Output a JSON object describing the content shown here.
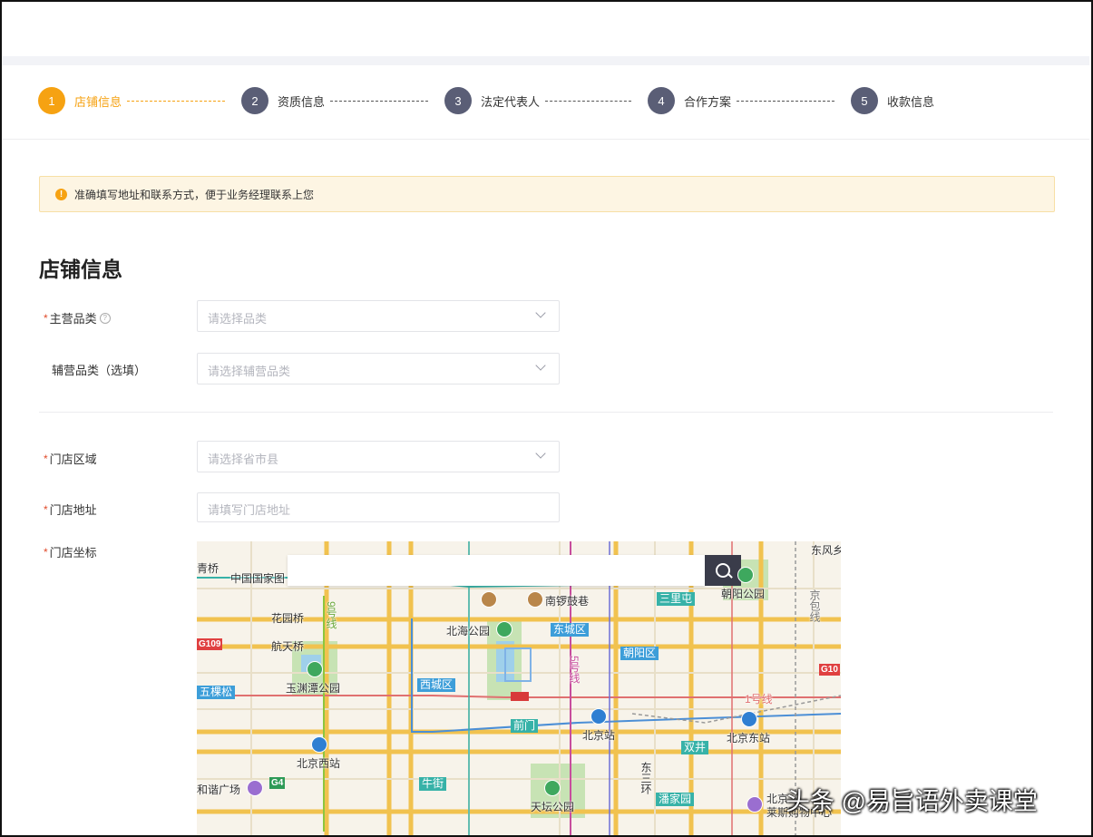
{
  "steps": [
    {
      "num": "1",
      "label": "店铺信息",
      "active": true
    },
    {
      "num": "2",
      "label": "资质信息",
      "active": false
    },
    {
      "num": "3",
      "label": "法定代表人",
      "active": false
    },
    {
      "num": "4",
      "label": "合作方案",
      "active": false
    },
    {
      "num": "5",
      "label": "收款信息",
      "active": false
    }
  ],
  "notice": {
    "icon": "warning-icon",
    "text": "准确填写地址和联系方式，便于业务经理联系上您"
  },
  "section_title": "店铺信息",
  "form": {
    "main_category": {
      "required_mark": "*",
      "label": "主营品类",
      "help_icon": "?",
      "placeholder": "请选择品类"
    },
    "sub_category": {
      "label": "辅营品类（选填）",
      "placeholder": "请选择辅营品类"
    },
    "store_region": {
      "required_mark": "*",
      "label": "门店区域",
      "placeholder": "请选择省市县"
    },
    "store_address": {
      "required_mark": "*",
      "label": "门店地址",
      "placeholder": "请填写门店地址"
    },
    "store_coordinates": {
      "required_mark": "*",
      "label": "门店坐标"
    }
  },
  "map": {
    "search_placeholder": "",
    "labels": {
      "l1": "青桥",
      "l2": "中国国家图",
      "l3": "南锣鼓巷",
      "l4": "朝阳公园",
      "l5": "东风乡",
      "l6": "花园桥",
      "l7": "航天桥",
      "l8": "北海公园",
      "l9": "玉渊潭公园",
      "l10": "北京站",
      "l11": "北京东站",
      "l12": "北京西站",
      "l13": "天坛公园",
      "l14": "和谐广场",
      "l15": "北京",
      "l16": "莱斯购物中心",
      "l17": "东三环",
      "l18": "京包线",
      "l19": "9号线",
      "l20": "5号线",
      "l21": "1号线"
    },
    "badges": {
      "b1": "三里屯",
      "b2": "东城区",
      "b3": "朝阳区",
      "b4": "西城区",
      "b5": "前门",
      "b6": "双井",
      "b7": "牛街",
      "b8": "潘家园",
      "b9": "五棵松"
    },
    "shields": {
      "s1": "G109",
      "s2": "G10",
      "s3": "G4"
    }
  },
  "watermark": "头条 @易旨语外卖课堂"
}
